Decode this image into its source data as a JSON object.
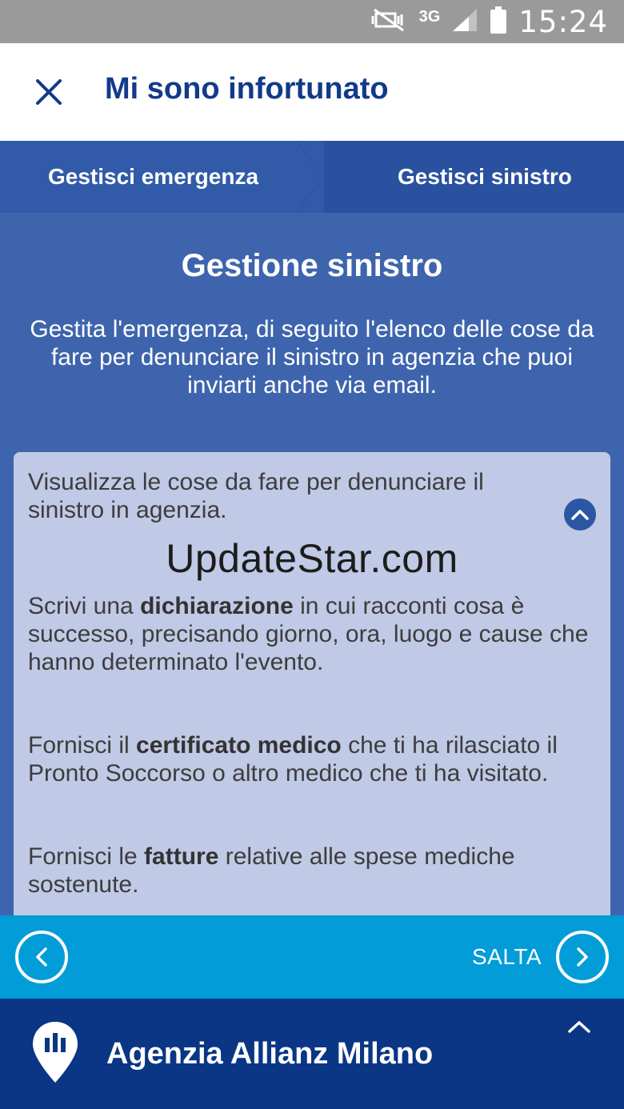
{
  "status_bar": {
    "network": "3G",
    "time": "15:24",
    "icons": [
      "mute-icon",
      "network-3g-icon",
      "signal-icon",
      "battery-icon"
    ]
  },
  "header": {
    "close_icon": "close-icon",
    "title": "Mi sono infortunato"
  },
  "steps": [
    {
      "label": "Gestisci emergenza",
      "active": true
    },
    {
      "label": "Gestisci sinistro",
      "active": false
    }
  ],
  "main": {
    "title": "Gestione sinistro",
    "intro": "Gestita l'emergenza, di seguito l'elenco delle cose da fare per denunciare il sinistro in agenzia che puoi inviarti anche via email."
  },
  "card": {
    "header": "Visualizza le cose da fare per denunciare il sinistro in agenzia.",
    "collapse_icon": "chevron-up-icon",
    "watermark": "UpdateStar.com",
    "items": [
      {
        "pre": "Scrivi una ",
        "bold": "dichiarazione",
        "post": " in cui racconti cosa è successo, precisando giorno, ora, luogo e cause che hanno determinato l'evento."
      },
      {
        "pre": "Fornisci il ",
        "bold": "certificato medico",
        "post": " che ti ha rilasciato il Pronto Soccorso o altro medico che ti ha visitato."
      },
      {
        "pre": "Fornisci le ",
        "bold": "fatture",
        "post": " relative alle spese mediche sostenute."
      }
    ]
  },
  "nav": {
    "back_icon": "chevron-left-icon",
    "skip_label": "SALTA",
    "next_icon": "chevron-right-icon"
  },
  "agency": {
    "icon": "location-pin-icon",
    "name": "Agenzia Allianz Milano",
    "expand_icon": "chevron-up-icon"
  },
  "colors": {
    "status_bar": "#9a9a9a",
    "header_text": "#113a8a",
    "steps_bg": "#2a51a0",
    "main_bg": "#3e64ad",
    "card_bg": "#c0c9e5",
    "nav_strip": "#029cd9",
    "agency_bar": "#0a3685"
  }
}
